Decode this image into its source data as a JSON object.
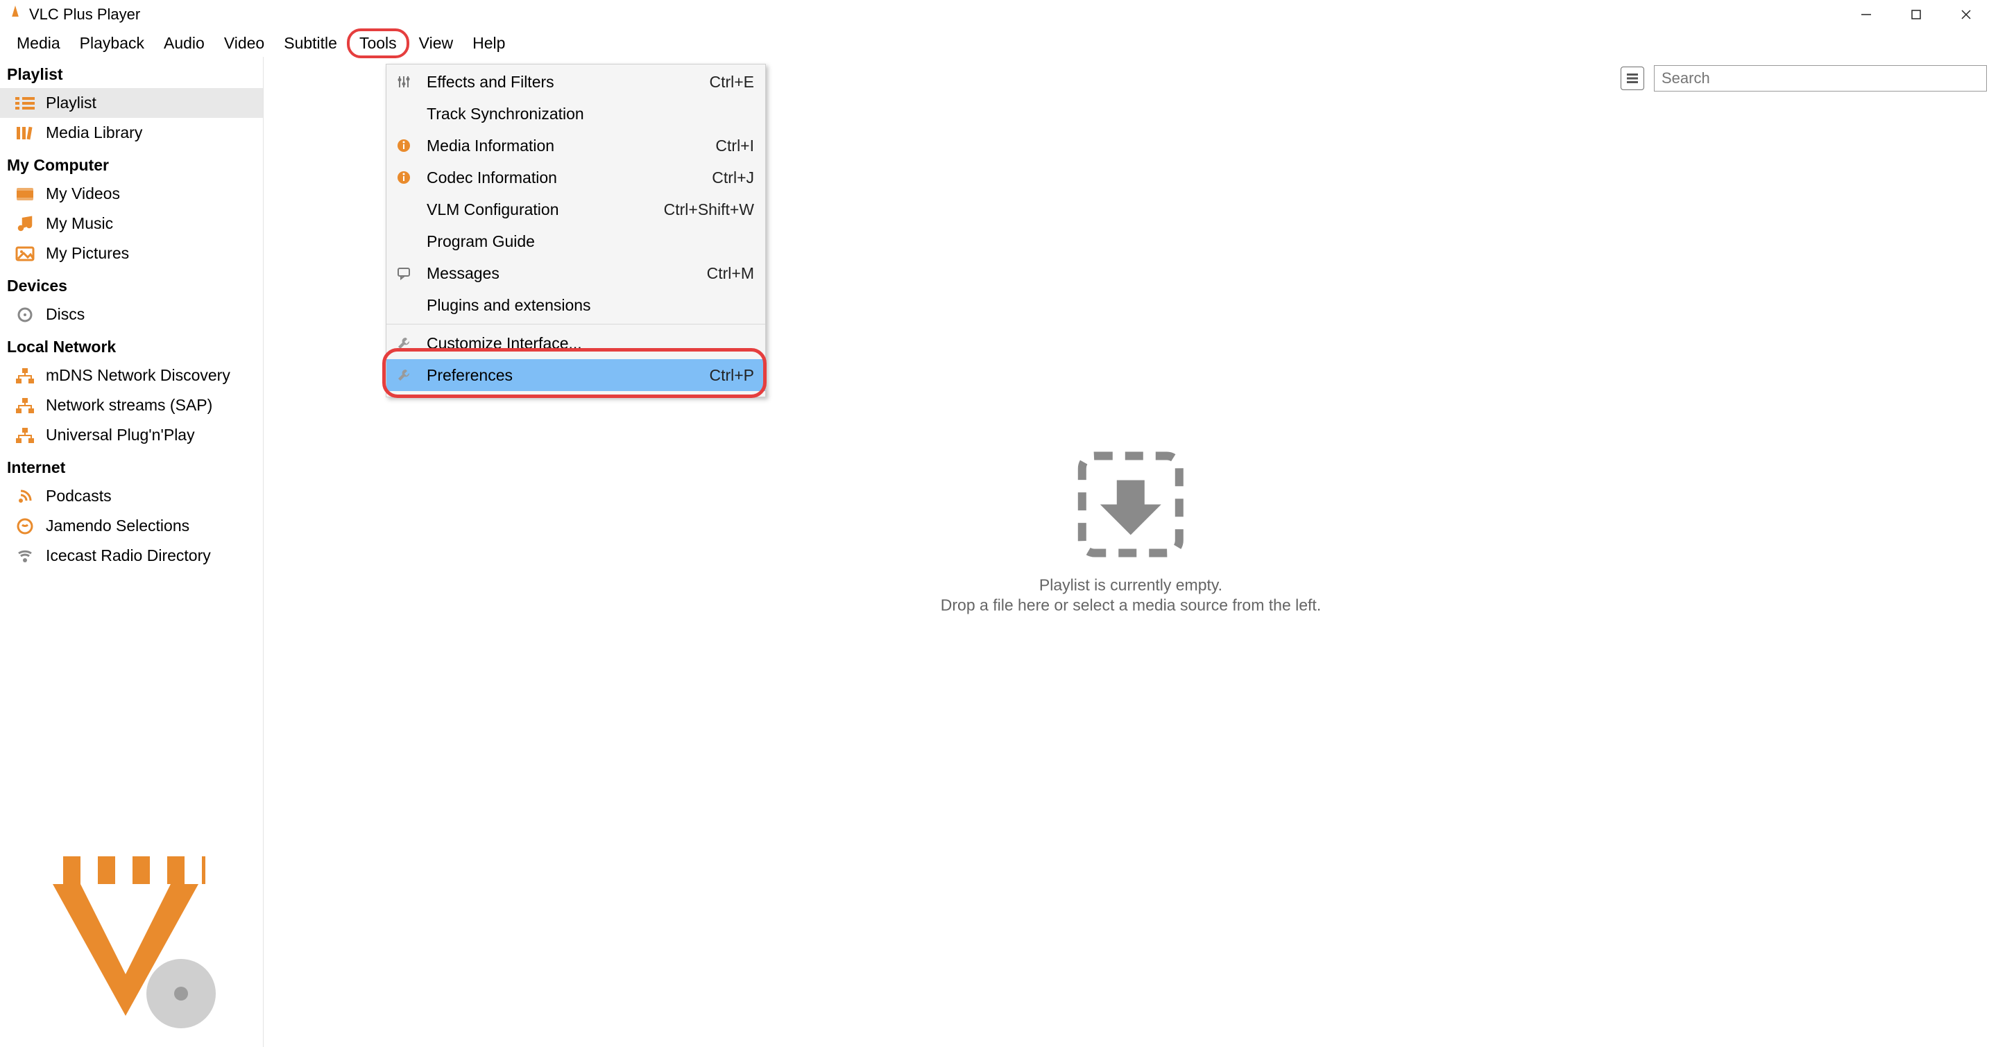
{
  "title": "VLC Plus Player",
  "menubar": [
    "Media",
    "Playback",
    "Audio",
    "Video",
    "Subtitle",
    "Tools",
    "View",
    "Help"
  ],
  "sidebar": {
    "playlist_header": "Playlist",
    "playlist_items": [
      "Playlist",
      "Media Library"
    ],
    "my_computer_header": "My Computer",
    "my_computer_items": [
      "My Videos",
      "My Music",
      "My Pictures"
    ],
    "devices_header": "Devices",
    "devices_items": [
      "Discs"
    ],
    "local_network_header": "Local Network",
    "local_network_items": [
      "mDNS Network Discovery",
      "Network streams (SAP)",
      "Universal Plug'n'Play"
    ],
    "internet_header": "Internet",
    "internet_items": [
      "Podcasts",
      "Jamendo Selections",
      "Icecast Radio Directory"
    ]
  },
  "search_placeholder": "Search",
  "empty_line1": "Playlist is currently empty.",
  "empty_line2": "Drop a file here or select a media source from the left.",
  "tools_menu": [
    {
      "icon": "sliders",
      "label": "Effects and Filters",
      "shortcut": "Ctrl+E"
    },
    {
      "icon": "",
      "label": "Track Synchronization",
      "shortcut": ""
    },
    {
      "icon": "info",
      "label": "Media Information",
      "shortcut": "Ctrl+I"
    },
    {
      "icon": "info",
      "label": "Codec Information",
      "shortcut": "Ctrl+J"
    },
    {
      "icon": "",
      "label": "VLM Configuration",
      "shortcut": "Ctrl+Shift+W"
    },
    {
      "icon": "",
      "label": "Program Guide",
      "shortcut": ""
    },
    {
      "icon": "message",
      "label": "Messages",
      "shortcut": "Ctrl+M"
    },
    {
      "icon": "",
      "label": "Plugins and extensions",
      "shortcut": ""
    },
    {
      "icon": "wrench",
      "label": "Customize Interface...",
      "shortcut": "",
      "sep_before": true
    },
    {
      "icon": "wrench",
      "label": "Preferences",
      "shortcut": "Ctrl+P",
      "highlight": true
    }
  ]
}
